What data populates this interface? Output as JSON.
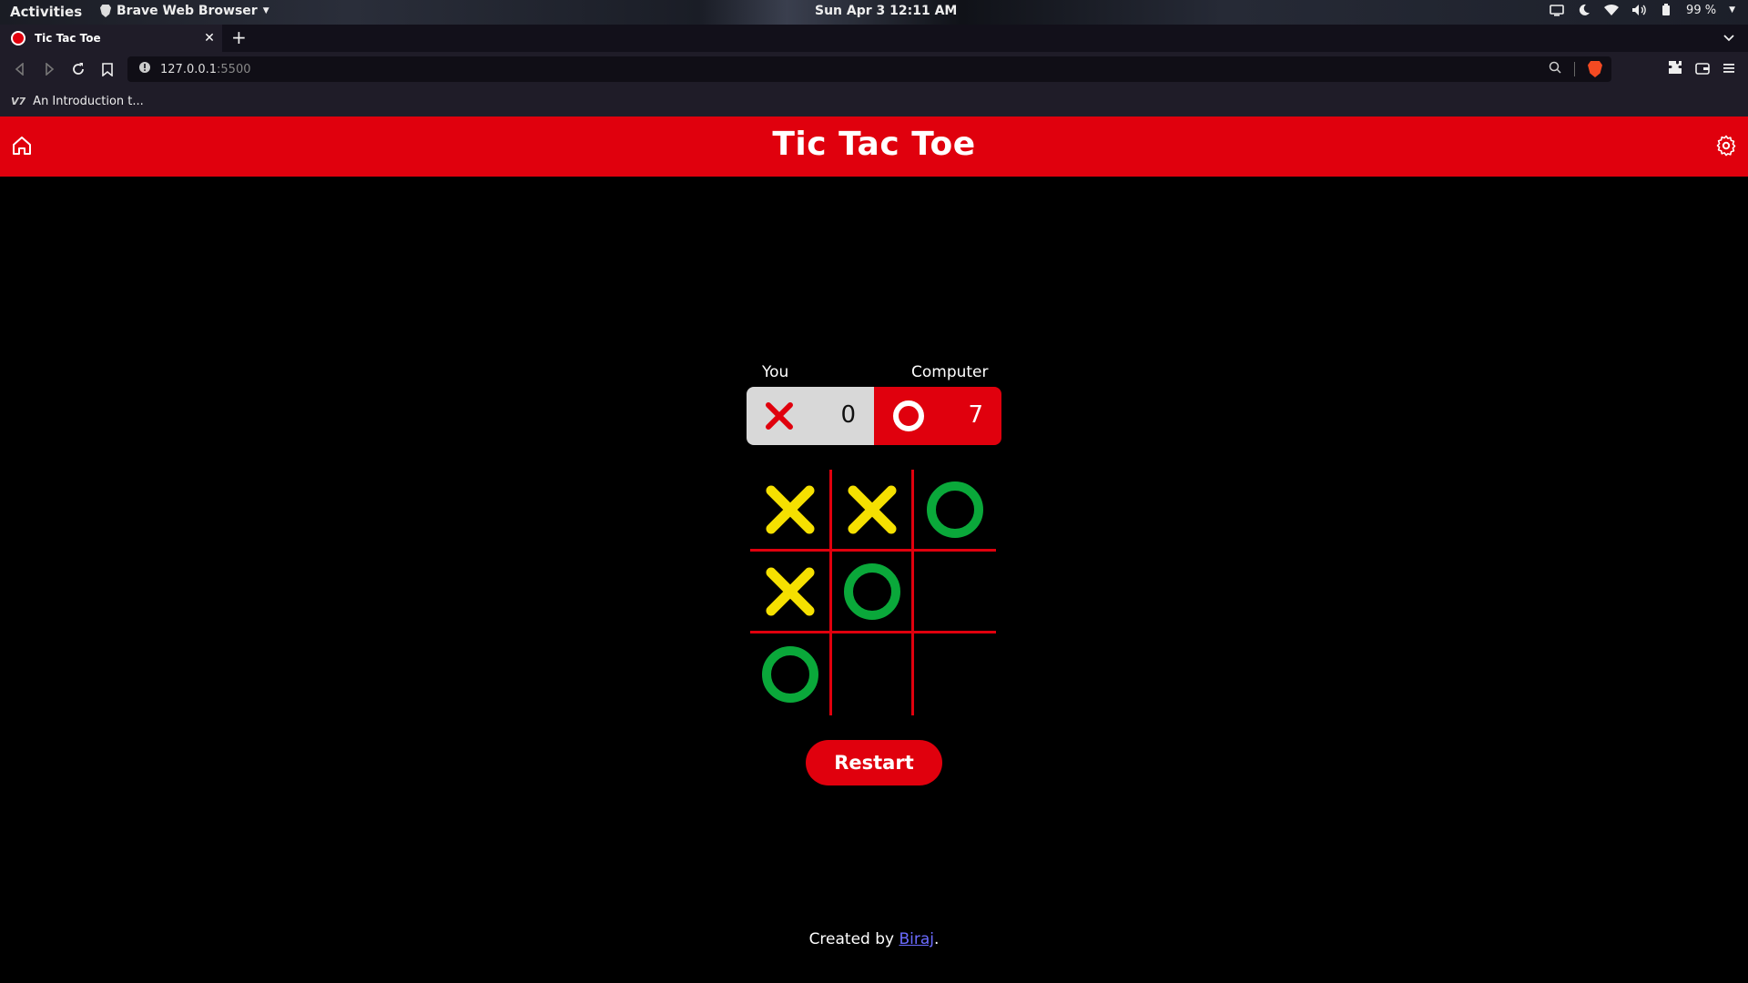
{
  "system": {
    "activities": "Activities",
    "app_name": "Brave Web Browser",
    "clock": "Sun Apr 3  12:11 AM",
    "battery": "99 %"
  },
  "browser": {
    "tab_title": "Tic Tac Toe",
    "url_host": "127.0.0.1",
    "url_port": ":5500",
    "bookmark_label": "An Introduction t..."
  },
  "page": {
    "title": "Tic Tac Toe",
    "players": {
      "you_label": "You",
      "computer_label": "Computer",
      "you_score": "0",
      "computer_score": "7"
    },
    "board": [
      [
        "X",
        "X",
        "O"
      ],
      [
        "X",
        "O",
        ""
      ],
      [
        "O",
        "",
        ""
      ]
    ],
    "restart_label": "Restart",
    "footer_prefix": "Created by ",
    "footer_link": "Biraj",
    "footer_suffix": "."
  },
  "colors": {
    "accent": "#e0000d",
    "x_mark": "#f5e000",
    "o_mark": "#0aa83a"
  }
}
